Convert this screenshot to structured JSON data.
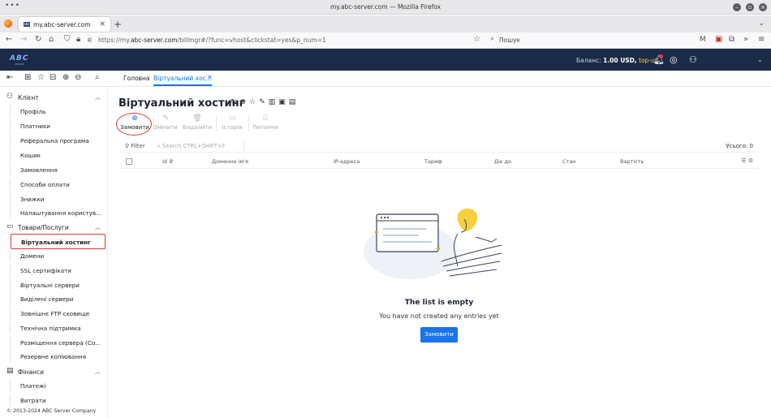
{
  "browser": {
    "window_title": "my.abc-server.com — Mozilla Firefox",
    "tab_title": "my.abc-server.com",
    "url_prefix": "https://my.",
    "url_domain": "abc-server.com",
    "url_rest": "/billmgr#/?func=vhost&clickstat=yes&p_num=1",
    "search_placeholder": "Пошук"
  },
  "header": {
    "balance_label": "Баланс:",
    "balance_amount": "1.00 USD,",
    "topup_label": "top-up"
  },
  "breadcrumbs": {
    "home": "Головна",
    "current": "Віртуальний хос..."
  },
  "sidebar": {
    "sections": [
      {
        "label": "Клієнт",
        "items": [
          "Профіль",
          "Платники",
          "Реферальна програма",
          "Кошик",
          "Замовлення",
          "Способи оплати",
          "Знижки",
          "Налаштування користув..."
        ]
      },
      {
        "label": "Товари/Послуги",
        "items": [
          "Віртуальний хостинг",
          "Домени",
          "SSL сертифікати",
          "Віртуальні сервери",
          "Виділені сервери",
          "Зовнішнє FTP сховище",
          "Технічна підтримка",
          "Розміщення сервера (Co...",
          "Резервне копіювання"
        ]
      },
      {
        "label": "Фінанси",
        "items": [
          "Платежі",
          "Витрати"
        ]
      }
    ],
    "active_item": "Віртуальний хостинг",
    "copyright": "© 2013-2024 ABC Server Company"
  },
  "main": {
    "title": "Віртуальний хостинг",
    "toolbar": {
      "order": "Замовити",
      "edit": "Змінити",
      "delete": "Видалити",
      "history": "Історія",
      "questions": "Питання"
    },
    "filter_label": "Filter",
    "search_placeholder": "Search CTRL+SHIFT+F",
    "total": "Усього: 0",
    "columns": [
      "Id",
      "Доменне ім'я",
      "IP-адреса",
      "Тариф",
      "Діє до",
      "Стан",
      "Вартість"
    ],
    "empty_title": "The list is empty",
    "empty_subtitle": "You have not created any entries yet",
    "empty_button": "Замовити"
  }
}
